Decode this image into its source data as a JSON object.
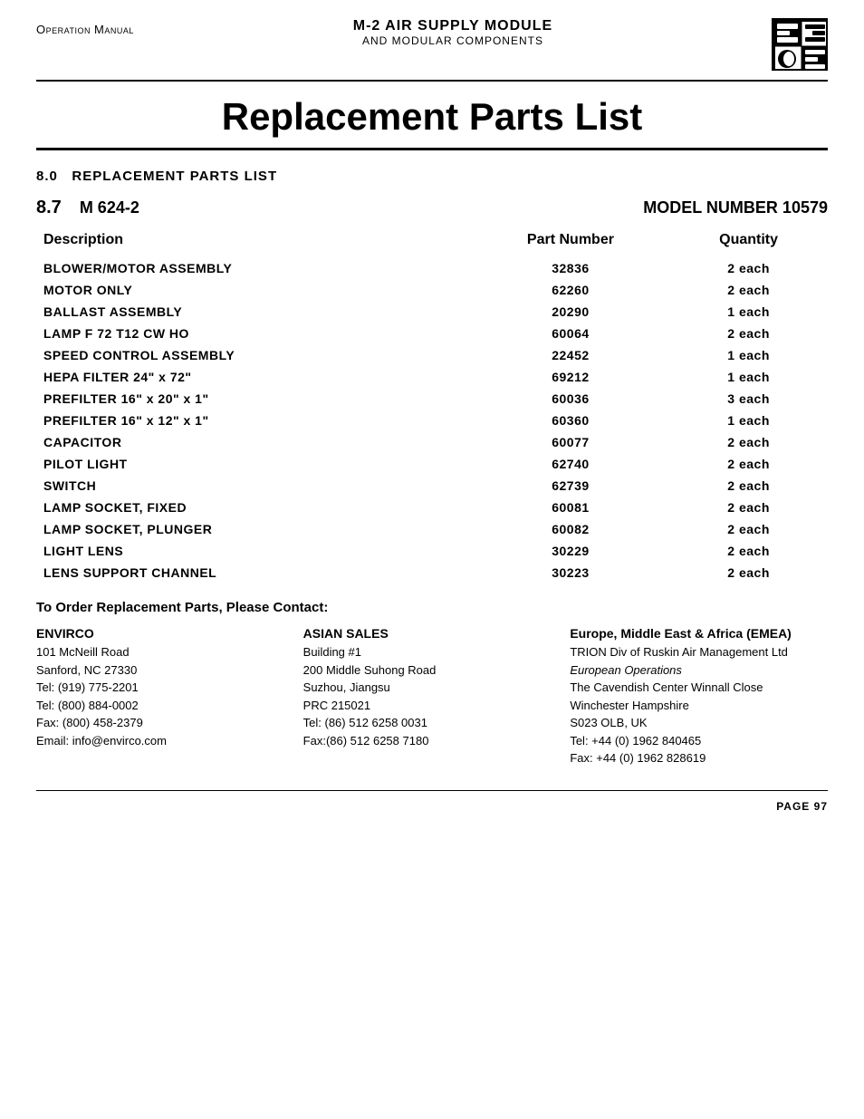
{
  "header": {
    "manual_label": "Operation Manual",
    "product_title": "M-2 AIR SUPPLY MODULE",
    "product_subtitle": "AND  MODULAR COMPONENTS"
  },
  "page_title": "Replacement Parts List",
  "section_80": {
    "number": "8.0",
    "title": "REPLACEMENT PARTS LIST"
  },
  "section_87": {
    "number": "8.7",
    "model_id": "M 624-2",
    "model_number_label": "MODEL NUMBER 10579"
  },
  "table": {
    "headers": {
      "description": "Description",
      "part_number": "Part Number",
      "quantity": "Quantity"
    },
    "rows": [
      {
        "description": "BLOWER/MOTOR ASSEMBLY",
        "part_number": "32836",
        "quantity": "2 each"
      },
      {
        "description": "MOTOR ONLY",
        "part_number": "62260",
        "quantity": "2 each"
      },
      {
        "description": "BALLAST ASSEMBLY",
        "part_number": "20290",
        "quantity": "1 each"
      },
      {
        "description": "LAMP  F 72 T12 CW HO",
        "part_number": "60064",
        "quantity": "2 each"
      },
      {
        "description": "SPEED CONTROL ASSEMBLY",
        "part_number": "22452",
        "quantity": "1 each"
      },
      {
        "description": "HEPA FILTER  24\" x 72\"",
        "part_number": "69212",
        "quantity": "1 each"
      },
      {
        "description": "PREFILTER   16\" x 20\" x 1\"",
        "part_number": "60036",
        "quantity": "3 each"
      },
      {
        "description": "PREFILTER   16\" x 12\" x 1\"",
        "part_number": "60360",
        "quantity": "1 each"
      },
      {
        "description": "CAPACITOR",
        "part_number": "60077",
        "quantity": "2 each"
      },
      {
        "description": "PILOT LIGHT",
        "part_number": "62740",
        "quantity": "2 each"
      },
      {
        "description": "SWITCH",
        "part_number": "62739",
        "quantity": "2 each"
      },
      {
        "description": "LAMP SOCKET, FIXED",
        "part_number": "60081",
        "quantity": "2 each"
      },
      {
        "description": "LAMP SOCKET, PLUNGER",
        "part_number": "60082",
        "quantity": "2 each"
      },
      {
        "description": "LIGHT LENS",
        "part_number": "30229",
        "quantity": "2 each"
      },
      {
        "description": "LENS SUPPORT CHANNEL",
        "part_number": "30223",
        "quantity": "2 each"
      }
    ]
  },
  "contact": {
    "order_title": "To Order Replacement Parts, Please Contact:",
    "envirco": {
      "name": "ENVIRCO",
      "lines": [
        "101 McNeill Road",
        "Sanford, NC 27330",
        "Tel:    (919) 775-2201",
        "Tel:    (800) 884-0002",
        "Fax:   (800) 458-2379",
        "Email: info@envirco.com"
      ]
    },
    "asian_sales": {
      "name": "ASIAN SALES",
      "lines": [
        "Building #1",
        "200 Middle Suhong Road",
        "Suzhou, Jiangsu",
        "PRC 215021",
        "Tel: (86) 512 6258 0031",
        "Fax:(86) 512 6258 7180"
      ]
    },
    "emea": {
      "name": "Europe, Middle East & Africa (EMEA)",
      "lines": [
        "TRION Div of Ruskin Air Management Ltd",
        "European Operations",
        "The Cavendish Center Winnall Close",
        "Winchester Hampshire",
        "S023 OLB, UK",
        "Tel: +44 (0) 1962 840465",
        "Fax: +44 (0) 1962 828619"
      ]
    }
  },
  "footer": {
    "page_label": "PAGE 97"
  }
}
